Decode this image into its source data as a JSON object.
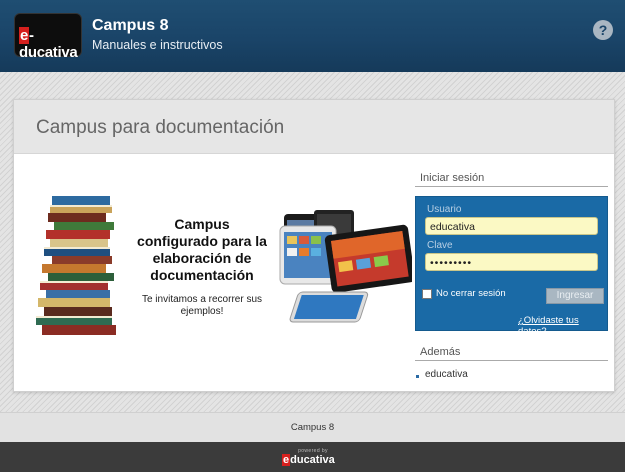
{
  "header": {
    "logo_text": "e-ducativa",
    "title": "Campus 8",
    "subtitle": "Manuales e instructivos",
    "help_glyph": "?"
  },
  "page": {
    "title": "Campus para documentación"
  },
  "promo": {
    "heading": "Campus configurado para la elaboración de documentación",
    "text": "Te invitamos a recorrer sus ejemplos!"
  },
  "login": {
    "section_label": "Iniciar sesión",
    "username_label": "Usuario",
    "username_value": "educativa",
    "password_label": "Clave",
    "password_value": "•••••••••",
    "remember_label": "No cerrar sesión",
    "remember_checked": false,
    "submit_label": "Ingresar",
    "forgot_link": "¿Olvidaste tus datos?"
  },
  "ademas": {
    "label": "Además",
    "items": [
      "educativa"
    ]
  },
  "footer": {
    "text": "Campus 8",
    "powered_small": "powered by",
    "powered_brand": "educativa"
  },
  "icons": {
    "help": "help-icon",
    "books": "books-illustration",
    "devices": "devices-illustration"
  },
  "colors": {
    "header": "#1a4468",
    "login_box": "#1a6aa6",
    "input_bg": "#fbf9c4",
    "brand_red": "#d6201e"
  }
}
